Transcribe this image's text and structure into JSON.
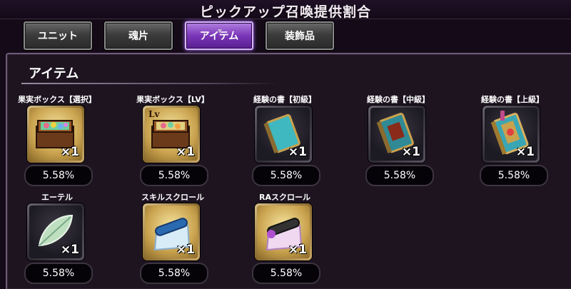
{
  "title": "ピックアップ召喚提供割合",
  "tabs": [
    {
      "label": "ユニット",
      "active": false
    },
    {
      "label": "魂片",
      "active": false
    },
    {
      "label": "アイテム",
      "active": true
    },
    {
      "label": "装飾品",
      "active": false
    }
  ],
  "section_title": "アイテム",
  "items": [
    {
      "name": "果実ボックス【選択】",
      "icon": "fruit-box-icon",
      "badge": "",
      "qty": "×1",
      "rate": "5.58%"
    },
    {
      "name": "果実ボックス【LV】",
      "icon": "fruit-box-lv-icon",
      "badge": "Lv",
      "qty": "×1",
      "rate": "5.58%"
    },
    {
      "name": "経験の書【初級】",
      "icon": "exp-book-beginner-icon",
      "badge": "",
      "qty": "×1",
      "rate": "5.58%"
    },
    {
      "name": "経験の書【中級】",
      "icon": "exp-book-intermediate-icon",
      "badge": "",
      "qty": "×1",
      "rate": "5.58%"
    },
    {
      "name": "経験の書【上級】",
      "icon": "exp-book-advanced-icon",
      "badge": "",
      "qty": "×1",
      "rate": "5.58%"
    },
    {
      "name": "エーテル",
      "icon": "ether-leaf-icon",
      "badge": "",
      "qty": "×1",
      "rate": "5.58%"
    },
    {
      "name": "スキルスクロール",
      "icon": "skill-scroll-icon",
      "badge": "",
      "qty": "×1",
      "rate": "5.58%"
    },
    {
      "name": "RAスクロール",
      "icon": "ra-scroll-icon",
      "badge": "",
      "qty": "×1",
      "rate": "5.58%"
    }
  ]
}
